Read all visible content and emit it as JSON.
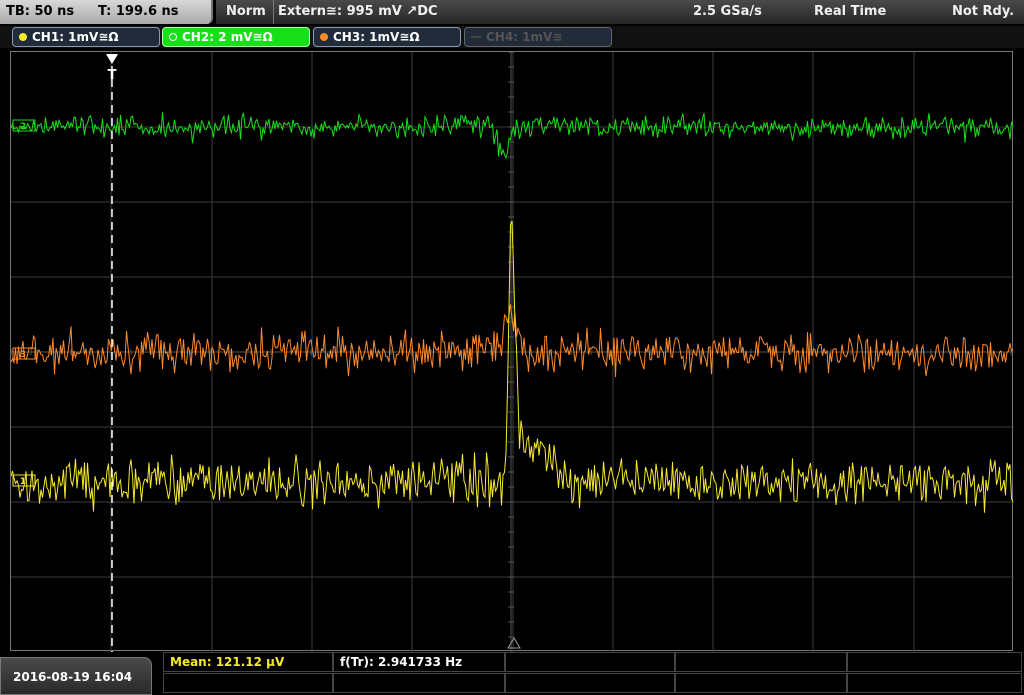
{
  "status": {
    "timebase": "TB: 50 ns",
    "trigger_time": "T: 199.6 ns",
    "mode": "Norm",
    "trigger_source": "Extern≅: 995 mV ↗DC",
    "sample_rate": "2.5 GSa/s",
    "acq_mode": "Real Time",
    "run_state": "Not Rdy."
  },
  "channels": [
    {
      "label": "CH1: 1mV≅Ω",
      "color": "#f5e92d",
      "active": false,
      "enabled": true
    },
    {
      "label": "CH2: 2 mV≅Ω",
      "color": "#18e018",
      "active": true,
      "enabled": true
    },
    {
      "label": "CH3: 1mV≅Ω",
      "color": "#ff8a2a",
      "active": false,
      "enabled": true
    },
    {
      "label": "CH4: 1mV≅",
      "color": "#555555",
      "active": false,
      "enabled": false
    }
  ],
  "markers": {
    "trigger_marker": "T",
    "ch1_ground": "1",
    "ch2_ground": "2",
    "ch3_ground": "3"
  },
  "measurements": {
    "mean": "Mean: 121.12 µV",
    "frequency": "f(Tr): 2.941733 Hz"
  },
  "datetime": "2016-08-19 16:04",
  "colors": {
    "ch1": "#f5e92d",
    "ch2": "#18e018",
    "ch3": "#ff8a2a",
    "grid": "#3c3c3c",
    "mean_text": "#f5e92d"
  }
}
